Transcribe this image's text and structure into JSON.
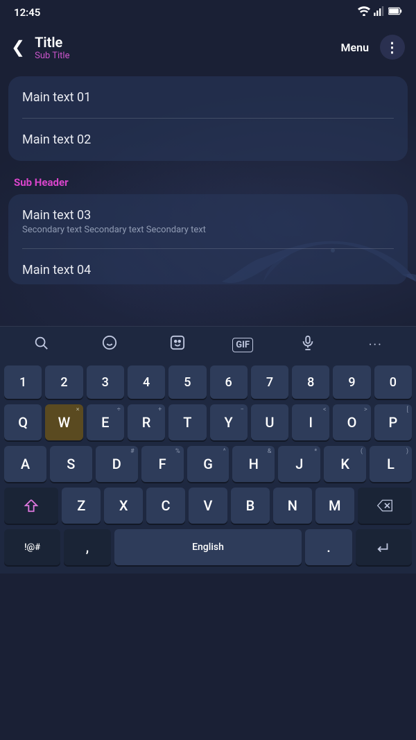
{
  "status": {
    "time": "12:45",
    "wifi_icon": "📶",
    "signal_icon": "📶",
    "battery_icon": "🔋"
  },
  "app_bar": {
    "title": "Title",
    "subtitle": "Sub Title",
    "menu_label": "Menu",
    "back_icon": "❮",
    "more_icon": "⋮"
  },
  "list1": {
    "item1": {
      "main": "Main text 01"
    },
    "item2": {
      "main": "Main text 02"
    }
  },
  "sub_header": "Sub Header",
  "list2": {
    "item3": {
      "main": "Main text 03",
      "secondary": "Secondary text Secondary text Secondary text"
    },
    "item4": {
      "main": "Main text 04"
    }
  },
  "keyboard": {
    "toolbar": {
      "search": "🔍",
      "emoji": "😊",
      "sticker": "🎭",
      "gif": "GIF",
      "mic": "🎤",
      "more": "•••"
    },
    "row_numbers": [
      "1",
      "2",
      "3",
      "4",
      "5",
      "6",
      "7",
      "8",
      "9",
      "0"
    ],
    "row_qwerty": [
      {
        "key": "Q",
        "sub": ""
      },
      {
        "key": "W",
        "sub": "×",
        "highlight": true
      },
      {
        "key": "E",
        "sub": "÷"
      },
      {
        "key": "R",
        "sub": "+"
      },
      {
        "key": "T",
        "sub": ""
      },
      {
        "key": "Y",
        "sub": "−"
      },
      {
        "key": "U",
        "sub": ""
      },
      {
        "key": "I",
        "sub": "<"
      },
      {
        "key": "O",
        "sub": ">"
      },
      {
        "key": "P",
        "sub": "["
      }
    ],
    "row_asdf": [
      {
        "key": "A",
        "sub": ""
      },
      {
        "key": "S",
        "sub": ""
      },
      {
        "key": "D",
        "sub": "#"
      },
      {
        "key": "F",
        "sub": "%"
      },
      {
        "key": "G",
        "sub": "^"
      },
      {
        "key": "H",
        "sub": "&"
      },
      {
        "key": "J",
        "sub": "*"
      },
      {
        "key": "K",
        "sub": "("
      },
      {
        "key": "L",
        "sub": ")"
      }
    ],
    "row_zxcv": [
      {
        "key": "Z",
        "sub": ""
      },
      {
        "key": "X",
        "sub": ""
      },
      {
        "key": "C",
        "sub": ""
      },
      {
        "key": "V",
        "sub": ""
      },
      {
        "key": "B",
        "sub": ""
      },
      {
        "key": "N",
        "sub": ""
      },
      {
        "key": "M",
        "sub": ""
      }
    ],
    "bottom_row": {
      "symbol_label": "!@#",
      "comma_label": ",",
      "space_label": "English",
      "period_label": ".",
      "enter_icon": "↵"
    }
  }
}
